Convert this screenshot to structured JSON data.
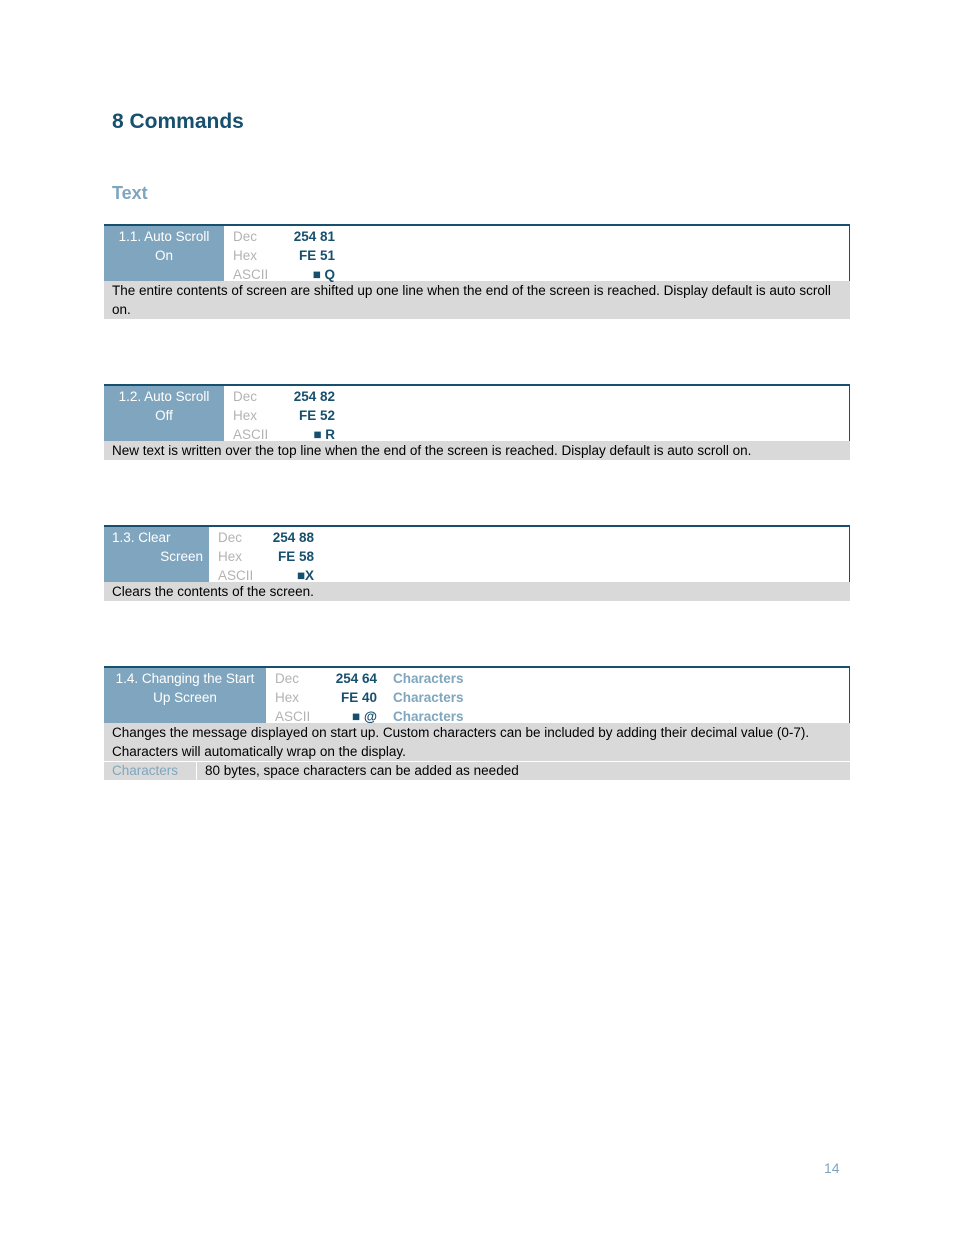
{
  "page_title": "8 Commands",
  "section_title": "Text",
  "commands": [
    {
      "name_line1": "1.1. Auto Scroll",
      "name_line2": "On",
      "dec_label": "Dec",
      "dec": "254 81",
      "hex_label": "Hex",
      "hex": "FE 51",
      "ascii_label": "ASCII",
      "ascii": "■ Q",
      "description": "The entire contents of screen are shifted up one line when the end of the screen is reached.  Display default is auto scroll on."
    },
    {
      "name_line1": "1.2. Auto Scroll",
      "name_line2": "Off",
      "dec_label": "Dec",
      "dec": "254 82",
      "hex_label": "Hex",
      "hex": "FE 52",
      "ascii_label": "ASCII",
      "ascii": "■ R",
      "description": "New text is written over the top line when the end of the screen is reached.  Display default is auto scroll on."
    },
    {
      "name_line1": "1.3. Clear",
      "name_line2": "Screen",
      "dec_label": "Dec",
      "dec": "254 88",
      "hex_label": "Hex",
      "hex": "FE 58",
      "ascii_label": "ASCII",
      "ascii": "■X",
      "description": "Clears the contents of the screen."
    },
    {
      "name_line1": "1.4. Changing the Start",
      "name_line2": "Up Screen",
      "dec_label": "Dec",
      "dec": "254 64",
      "hex_label": "Hex",
      "hex": "FE 40",
      "ascii_label": "ASCII",
      "ascii": "■ @",
      "param": "Characters",
      "description": "Changes the message displayed on start up.  Custom characters can be included by adding their decimal value (0-7).  Characters will automatically wrap on the display.",
      "param_name": "Characters",
      "param_desc": "80 bytes, space characters can be added as needed"
    }
  ],
  "page_number": "14"
}
